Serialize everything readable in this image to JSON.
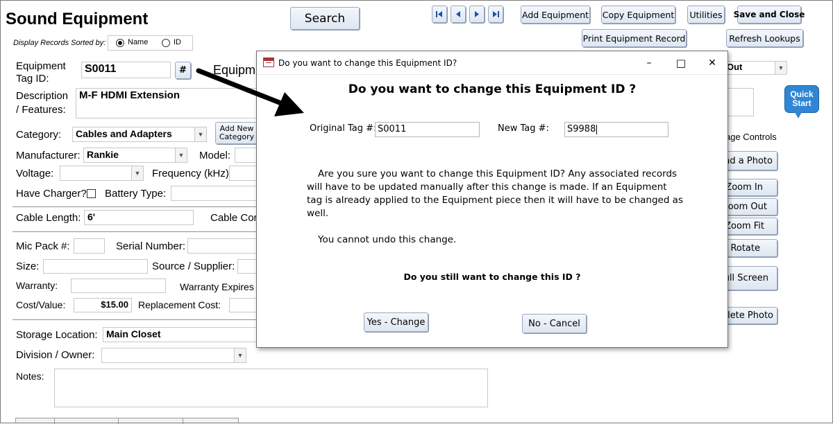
{
  "app": {
    "title": "Sound Equipment",
    "sort": {
      "label": "Display Records Sorted by:",
      "options": [
        "Name",
        "ID"
      ],
      "selected": "Name"
    }
  },
  "toolbar": {
    "search": "Search",
    "add_equipment": "Add Equipment",
    "copy_equipment": "Copy Equipment",
    "utilities": "Utilities",
    "save_close": "Save and Close",
    "print_record": "Print Equipment Record",
    "refresh_lookups": "Refresh Lookups"
  },
  "nav_icons": [
    "first-record-icon",
    "previous-record-icon",
    "next-record-icon",
    "last-record-icon"
  ],
  "form": {
    "tag_label_1": "Equipment",
    "tag_label_2": "Tag ID:",
    "tag_value": "S0011",
    "hash_button": "#",
    "equipment_label_partial": "Equipm",
    "desc_label_1": "Description",
    "desc_label_2": "/ Features:",
    "desc_value": "M-F HDMI Extension",
    "category_label": "Category:",
    "category_value": "Cables and Adapters",
    "add_new_category_line1": "Add New",
    "add_new_category_line2": "Category",
    "manufacturer_label": "Manufacturer:",
    "manufacturer_value": "Rankie",
    "model_label": "Model:",
    "voltage_label": "Voltage:",
    "frequency_label": "Frequency (kHz):",
    "charger_label": "Have Charger?",
    "battery_label": "Battery Type:",
    "cable_length_label": "Cable Length:",
    "cable_length_value": "6'",
    "cable_conn_label": "Cable Cor",
    "mic_pack_label": "Mic Pack #:",
    "serial_label": "Serial Number:",
    "size_label": "Size:",
    "source_label": "Source / Supplier:",
    "warranty_label": "Warranty:",
    "warranty_expires_label": "Warranty Expires",
    "cost_label": "Cost/Value:",
    "cost_value": "$15.00",
    "replacement_label": "Replacement Cost:",
    "storage_label": "Storage Location:",
    "storage_value": "Main Closet",
    "division_label": "Division / Owner:",
    "notes_label": "Notes:",
    "status_value_partial": "Out"
  },
  "image_panel": {
    "quick_start_1": "Quick",
    "quick_start_2": "Start",
    "controls_label": "age Controls",
    "load_photo": "oad a Photo",
    "zoom_in": "Zoom In",
    "zoom_out": "Zoom Out",
    "zoom_fit": "Zoom Fit",
    "rotate": "Rotate",
    "full_screen": "Full Screen",
    "delete_photo": "elete Photo"
  },
  "dialog": {
    "window_title": "Do you want to change this Equipment ID?",
    "heading": "Do you want to change this Equipment ID ?",
    "original_label": "Original Tag #:",
    "original_value": "S0011",
    "new_label": "New Tag #:",
    "new_value": "S9988",
    "para1_line1": "Are you sure you want to change this Equipment ID?  Any associated records",
    "para1_line2": "will have to be updated manually after this change is made.  If an Equipment",
    "para1_line3": "tag is already applied to the Equipment piece then it will have to be changed as",
    "para1_line4": "well.",
    "para2": "You cannot undo this change.",
    "confirm": "Do you still want to change this ID ?",
    "yes_button": "Yes - Change",
    "no_button": "No - Cancel",
    "minimize": "–",
    "maximize": "□",
    "close": "✕"
  },
  "colors": {
    "quick_start": "#2f86d4",
    "button_border": "#9aa8bd",
    "nav_arrow": "#1f4fa8"
  }
}
